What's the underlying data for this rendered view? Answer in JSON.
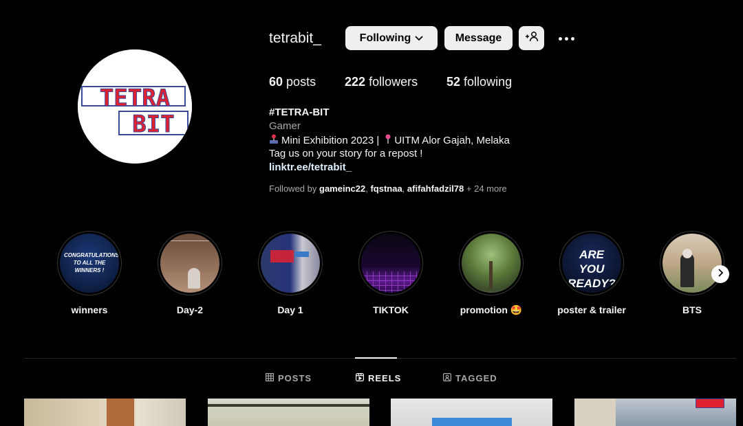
{
  "profile": {
    "username": "tetrabit_",
    "following_button": "Following",
    "message_button": "Message",
    "stats": {
      "posts_count": "60",
      "posts_label": "posts",
      "followers_count": "222",
      "followers_label": "followers",
      "following_count": "52",
      "following_label": "following"
    },
    "bio": {
      "name": "#TETRA-BIT",
      "category": "Gamer",
      "line1_part1": "Mini Exhibition 2023 |",
      "line1_part2": "UITM Alor Gajah, Melaka",
      "line2": "Tag us on your story for a repost !",
      "link": "linktr.ee/tetrabit_"
    },
    "followed_by": {
      "prefix": "Followed by",
      "users": [
        "gameinc22",
        "fqstnaa",
        "afifahfadzil78"
      ],
      "more": "+ 24 more"
    },
    "avatar_logo_text": [
      "TETRA",
      "BIT"
    ]
  },
  "highlights": [
    {
      "label": "winners",
      "thumb_text": "CONGRATULATIONS TO ALL THE WINNERS !"
    },
    {
      "label": "Day-2"
    },
    {
      "label": "Day 1"
    },
    {
      "label": "TIKTOK"
    },
    {
      "label": "promotion 🤩"
    },
    {
      "label": "poster & trailer",
      "thumb_text": "ARE YOU READY?"
    },
    {
      "label": "BTS"
    }
  ],
  "tabs": [
    {
      "label": "POSTS",
      "icon": "grid-icon"
    },
    {
      "label": "REELS",
      "icon": "reels-icon",
      "active": true
    },
    {
      "label": "TAGGED",
      "icon": "tagged-icon"
    }
  ],
  "colors": {
    "background": "#000000",
    "button_bg": "#efefef",
    "muted_text": "#a8a8a8",
    "link": "#e0f1ff"
  }
}
